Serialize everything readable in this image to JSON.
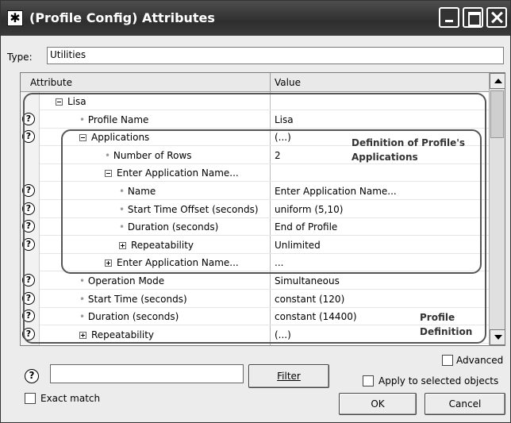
{
  "window": {
    "title": "(Profile Config) Attributes",
    "icon": "asterisk-icon"
  },
  "type": {
    "label": "Type:",
    "value": "Utilities"
  },
  "grid": {
    "headers": {
      "attribute": "Attribute",
      "value": "Value"
    },
    "rows": [
      {
        "name": "Lisa",
        "value": "",
        "help": false,
        "indent": 1,
        "expander": "minus"
      },
      {
        "name": "Profile Name",
        "value": "Lisa",
        "help": true,
        "indent": 2,
        "expander": ""
      },
      {
        "name": "Applications",
        "value": "(...)",
        "help": true,
        "indent": 2,
        "expander": "minus"
      },
      {
        "name": "Number of Rows",
        "value": "2",
        "help": false,
        "indent": 3,
        "expander": ""
      },
      {
        "name": "Enter Application Name...",
        "value": "",
        "help": false,
        "indent": 3,
        "expander": "minus"
      },
      {
        "name": "Name",
        "value": "Enter Application Name...",
        "help": true,
        "indent": 4,
        "expander": ""
      },
      {
        "name": "Start Time Offset (seconds)",
        "value": "uniform (5,10)",
        "help": true,
        "indent": 4,
        "expander": ""
      },
      {
        "name": "Duration (seconds)",
        "value": "End of Profile",
        "help": true,
        "indent": 4,
        "expander": ""
      },
      {
        "name": "Repeatability",
        "value": "Unlimited",
        "help": true,
        "indent": 4,
        "expander": "plus"
      },
      {
        "name": "Enter Application Name...",
        "value": "...",
        "help": false,
        "indent": 3,
        "expander": "plus"
      },
      {
        "name": "Operation Mode",
        "value": "Simultaneous",
        "help": true,
        "indent": 2,
        "expander": ""
      },
      {
        "name": "Start Time (seconds)",
        "value": "constant (120)",
        "help": true,
        "indent": 2,
        "expander": ""
      },
      {
        "name": "Duration (seconds)",
        "value": "constant (14400)",
        "help": true,
        "indent": 2,
        "expander": ""
      },
      {
        "name": "Repeatability",
        "value": "(...)",
        "help": true,
        "indent": 2,
        "expander": "plus"
      }
    ]
  },
  "annotations": {
    "applications_line1": "Definition of Profile's",
    "applications_line2": "Applications",
    "profile_line1": "Profile",
    "profile_line2": "Definition"
  },
  "bottom": {
    "advanced": "Advanced",
    "apply_selected": "Apply to selected objects",
    "filter_button": "Filter",
    "exact_match": "Exact match",
    "ok": "OK",
    "cancel": "Cancel",
    "filter_value": ""
  }
}
